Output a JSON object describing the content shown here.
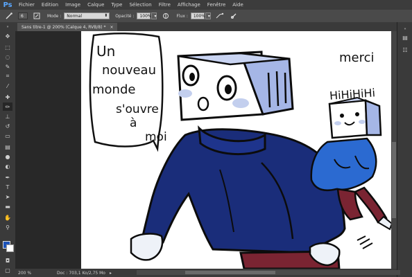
{
  "app": {
    "logo": "Ps"
  },
  "menu": [
    "Fichier",
    "Edition",
    "Image",
    "Calque",
    "Type",
    "Sélection",
    "Filtre",
    "Affichage",
    "Fenêtre",
    "Aide"
  ],
  "options": {
    "brush_size": "6",
    "mode_label": "Mode :",
    "mode_value": "Normal",
    "opacity_label": "Opacité :",
    "opacity_value": "100%",
    "flow_label": "Flux :",
    "flow_value": "100%"
  },
  "document": {
    "tab_title": "Sans titre-1 @ 200% (Calque 4, RVB/8) *",
    "close": "×"
  },
  "status": {
    "zoom": "200 %",
    "doc_size": "Doc : 703,1 Ko/2,75 Mo",
    "arrow": "▸"
  },
  "artwork": {
    "speech": [
      "Un",
      "nouveau",
      "monde",
      "s'ouvre",
      "à",
      "moi"
    ],
    "merci": "merci",
    "laugh": [
      "HiHiHiHi"
    ]
  },
  "colors": {
    "foreground": "#1d53b8",
    "background": "#ffffff",
    "accent": "#5aa7ff"
  },
  "tools": [
    "move-icon",
    "marquee-icon",
    "lasso-icon",
    "quick-select-icon",
    "crop-icon",
    "eyedropper-icon",
    "healing-icon",
    "brush-icon",
    "stamp-icon",
    "history-brush-icon",
    "eraser-icon",
    "gradient-icon",
    "blur-icon",
    "dodge-icon",
    "pen-icon",
    "type-icon",
    "path-select-icon",
    "shape-icon",
    "hand-icon",
    "zoom-icon"
  ]
}
